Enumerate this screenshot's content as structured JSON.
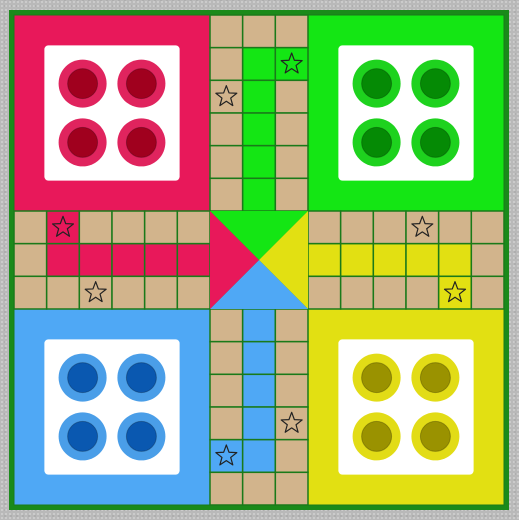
{
  "game": "Ludo",
  "colors": {
    "frame": "#1a8a1a",
    "cell": "#d2b48c",
    "grid_line": "#1a7a1a",
    "red": "#e8185a",
    "green": "#14e614",
    "blue": "#4fa8f5",
    "yellow": "#e2e012",
    "star_stroke": "#222222"
  },
  "bases": [
    {
      "id": "red",
      "color": "#e8185a",
      "token_ring": "#e0245e",
      "token_fill": "#a0001e",
      "tokens": 4
    },
    {
      "id": "green",
      "color": "#14e614",
      "token_ring": "#1ed21e",
      "token_fill": "#058a05",
      "tokens": 4
    },
    {
      "id": "blue",
      "color": "#4fa8f5",
      "token_ring": "#4a9ee8",
      "token_fill": "#0a58b0",
      "tokens": 4
    },
    {
      "id": "yellow",
      "color": "#e2e012",
      "token_ring": "#e2dc16",
      "token_fill": "#9a9200",
      "tokens": 4
    }
  ],
  "home_triangles": [
    "green",
    "yellow",
    "blue",
    "red"
  ],
  "safe_stars": [
    {
      "col": 8,
      "row": 1,
      "fill": "#14e614"
    },
    {
      "col": 6,
      "row": 2,
      "fill": "none"
    },
    {
      "col": 1,
      "row": 6,
      "fill": "#e8185a"
    },
    {
      "col": 12,
      "row": 6,
      "fill": "none"
    },
    {
      "col": 2,
      "row": 8,
      "fill": "none"
    },
    {
      "col": 13,
      "row": 8,
      "fill": "#e2e012"
    },
    {
      "col": 8,
      "row": 12,
      "fill": "none"
    },
    {
      "col": 6,
      "row": 13,
      "fill": "#4fa8f5"
    }
  ]
}
